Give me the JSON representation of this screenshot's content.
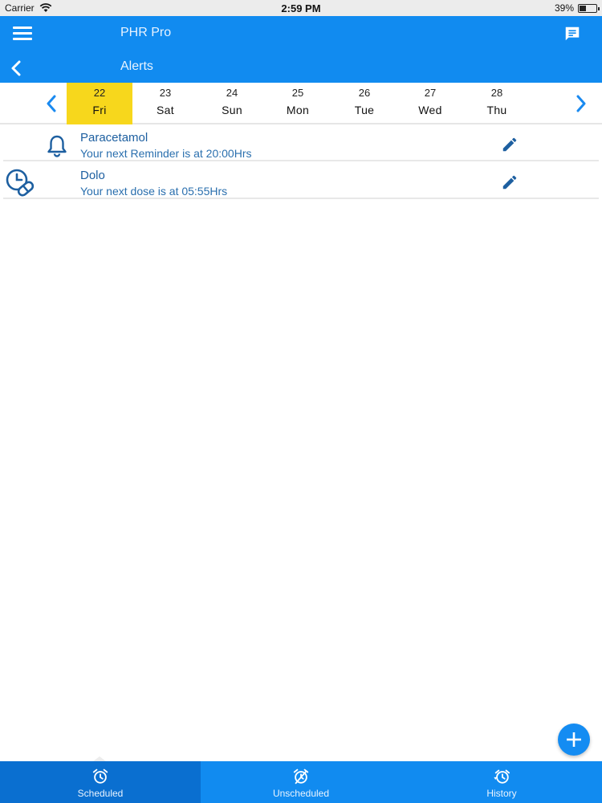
{
  "status_bar": {
    "carrier": "Carrier",
    "time": "2:59 PM",
    "battery": "39%",
    "battery_level": 0.39
  },
  "header": {
    "app_title": "PHR Pro",
    "page_title": "Alerts"
  },
  "calendar": {
    "days": [
      {
        "num": "22",
        "name": "Fri",
        "selected": true
      },
      {
        "num": "23",
        "name": "Sat"
      },
      {
        "num": "24",
        "name": "Sun"
      },
      {
        "num": "25",
        "name": "Mon"
      },
      {
        "num": "26",
        "name": "Tue"
      },
      {
        "num": "27",
        "name": "Wed"
      },
      {
        "num": "28",
        "name": "Thu"
      }
    ]
  },
  "alerts": [
    {
      "icon": "bell-icon",
      "name": "Paracetamol",
      "subtitle": "Your next Reminder is at 20:00Hrs"
    },
    {
      "icon": "pill-clock-icon",
      "name": "Dolo",
      "subtitle": "Your next dose is at 05:55Hrs"
    }
  ],
  "tabs": [
    {
      "label": "Scheduled",
      "icon": "alarm-clock-icon",
      "active": true
    },
    {
      "label": "Unscheduled",
      "icon": "alarm-off-icon"
    },
    {
      "label": "History",
      "icon": "alarm-history-icon"
    }
  ],
  "colors": {
    "primary": "#118bf0",
    "selected_day": "#f7d71c",
    "text_blue": "#1d5fa0",
    "active_tab": "#0a6fd0"
  }
}
